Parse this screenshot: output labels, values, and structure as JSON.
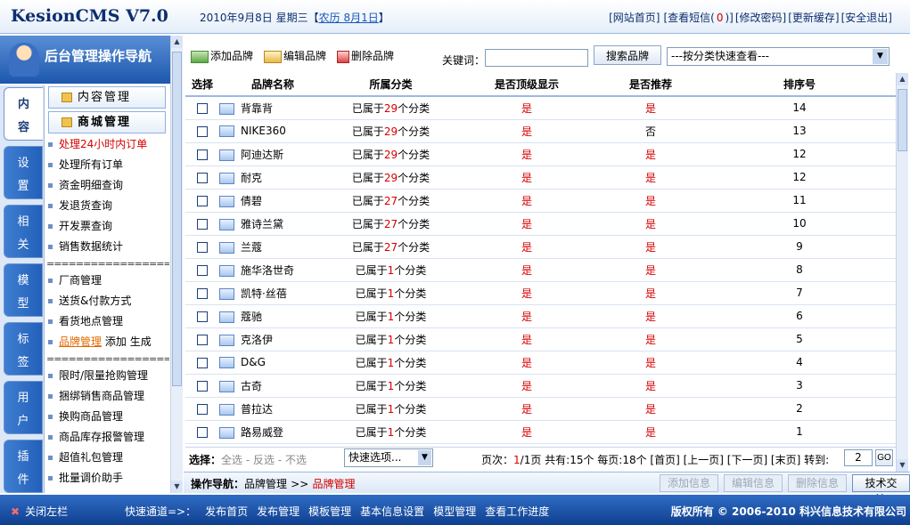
{
  "header": {
    "logo": "KesionCMS V7.0",
    "date": "2010年9月8日 星期三【",
    "lunar": "农历 8月1日",
    "date_end": "】",
    "links": [
      "[网站首页]",
      "[查看短信(",
      "0",
      ")]",
      "[修改密码]",
      "[更新缓存]",
      "[安全退出]"
    ]
  },
  "sidebar": {
    "title": "后台管理操作导航",
    "tabs": [
      {
        "l1": "内",
        "l2": "容"
      },
      {
        "l1": "设",
        "l2": "置"
      },
      {
        "l1": "相",
        "l2": "关"
      },
      {
        "l1": "模",
        "l2": "型"
      },
      {
        "l1": "标",
        "l2": "签"
      },
      {
        "l1": "用",
        "l2": "户"
      },
      {
        "l1": "插",
        "l2": "件"
      }
    ],
    "section1": "内容管理",
    "section2": "商城管理",
    "items": [
      "处理24小时内订单",
      "处理所有订单",
      "资金明细查询",
      "发退货查询",
      "开发票查询",
      "销售数据统计",
      "厂商管理",
      "送货&付款方式",
      "看货地点管理",
      "品牌管理",
      "限时/限量抢购管理",
      "捆绑销售商品管理",
      "换购商品管理",
      "商品库存报警管理",
      "超值礼包管理",
      "批量调价助手"
    ],
    "separator": "===================",
    "brand_add": "添加",
    "brand_gen": "生成"
  },
  "toolbar": {
    "add": "添加品牌",
    "edit": "编辑品牌",
    "delete": "删除品牌",
    "keyword_label": "关键词：",
    "keyword_value": "",
    "search": "搜索品牌",
    "category": "---按分类快速查看---"
  },
  "table": {
    "headers": [
      "选择",
      "品牌名称",
      "所属分类",
      "是否顶级显示",
      "是否推荐",
      "排序号"
    ],
    "cat_prefix": "已属于",
    "cat_suffix": "个分类",
    "rows": [
      {
        "name": "背靠背",
        "cats": "29",
        "top": "是",
        "rec": "是",
        "order": "14"
      },
      {
        "name": "NIKE360",
        "cats": "29",
        "top": "是",
        "rec": "否",
        "order": "13"
      },
      {
        "name": "阿迪达斯",
        "cats": "29",
        "top": "是",
        "rec": "是",
        "order": "12"
      },
      {
        "name": "耐克",
        "cats": "29",
        "top": "是",
        "rec": "是",
        "order": "12"
      },
      {
        "name": "倩碧",
        "cats": "27",
        "top": "是",
        "rec": "是",
        "order": "11"
      },
      {
        "name": "雅诗兰黛",
        "cats": "27",
        "top": "是",
        "rec": "是",
        "order": "10"
      },
      {
        "name": "兰蔻",
        "cats": "27",
        "top": "是",
        "rec": "是",
        "order": "9"
      },
      {
        "name": "施华洛世奇",
        "cats": "1",
        "top": "是",
        "rec": "是",
        "order": "8"
      },
      {
        "name": "凯特·丝蓓",
        "cats": "1",
        "top": "是",
        "rec": "是",
        "order": "7"
      },
      {
        "name": "蔻驰",
        "cats": "1",
        "top": "是",
        "rec": "是",
        "order": "6"
      },
      {
        "name": "克洛伊",
        "cats": "1",
        "top": "是",
        "rec": "是",
        "order": "5"
      },
      {
        "name": "D&G",
        "cats": "1",
        "top": "是",
        "rec": "是",
        "order": "4"
      },
      {
        "name": "古奇",
        "cats": "1",
        "top": "是",
        "rec": "是",
        "order": "3"
      },
      {
        "name": "普拉达",
        "cats": "1",
        "top": "是",
        "rec": "是",
        "order": "2"
      },
      {
        "name": "路易威登",
        "cats": "1",
        "top": "是",
        "rec": "是",
        "order": "1"
      }
    ]
  },
  "pager": {
    "select_label": "选择：",
    "all": "全选",
    "reverse": "反选",
    "none": "不选",
    "quick": "快速选项...",
    "pre": "页次：",
    "current": "1",
    "post": "/1页 共有:15个 每页:18个 [首页] [上一页] [下一页] [末页] 转到:",
    "goto": "2",
    "go": "GO"
  },
  "opbar": {
    "label": "操作导航：",
    "crumb1": "品牌管理",
    "sep": ">>",
    "crumb2": "品牌管理",
    "btn_add": "添加信息",
    "btn_edit": "编辑信息",
    "btn_del": "删除信息",
    "btn_tech": "技术交流"
  },
  "footer": {
    "close": "关闭左栏",
    "quick_label": "快速通道=>：",
    "links": [
      "发布首页",
      "发布管理",
      "模板管理",
      "基本信息设置",
      "模型管理",
      "查看工作进度"
    ],
    "copyright": "版权所有 © 2006-2010 科兴信息技术有限公司"
  }
}
